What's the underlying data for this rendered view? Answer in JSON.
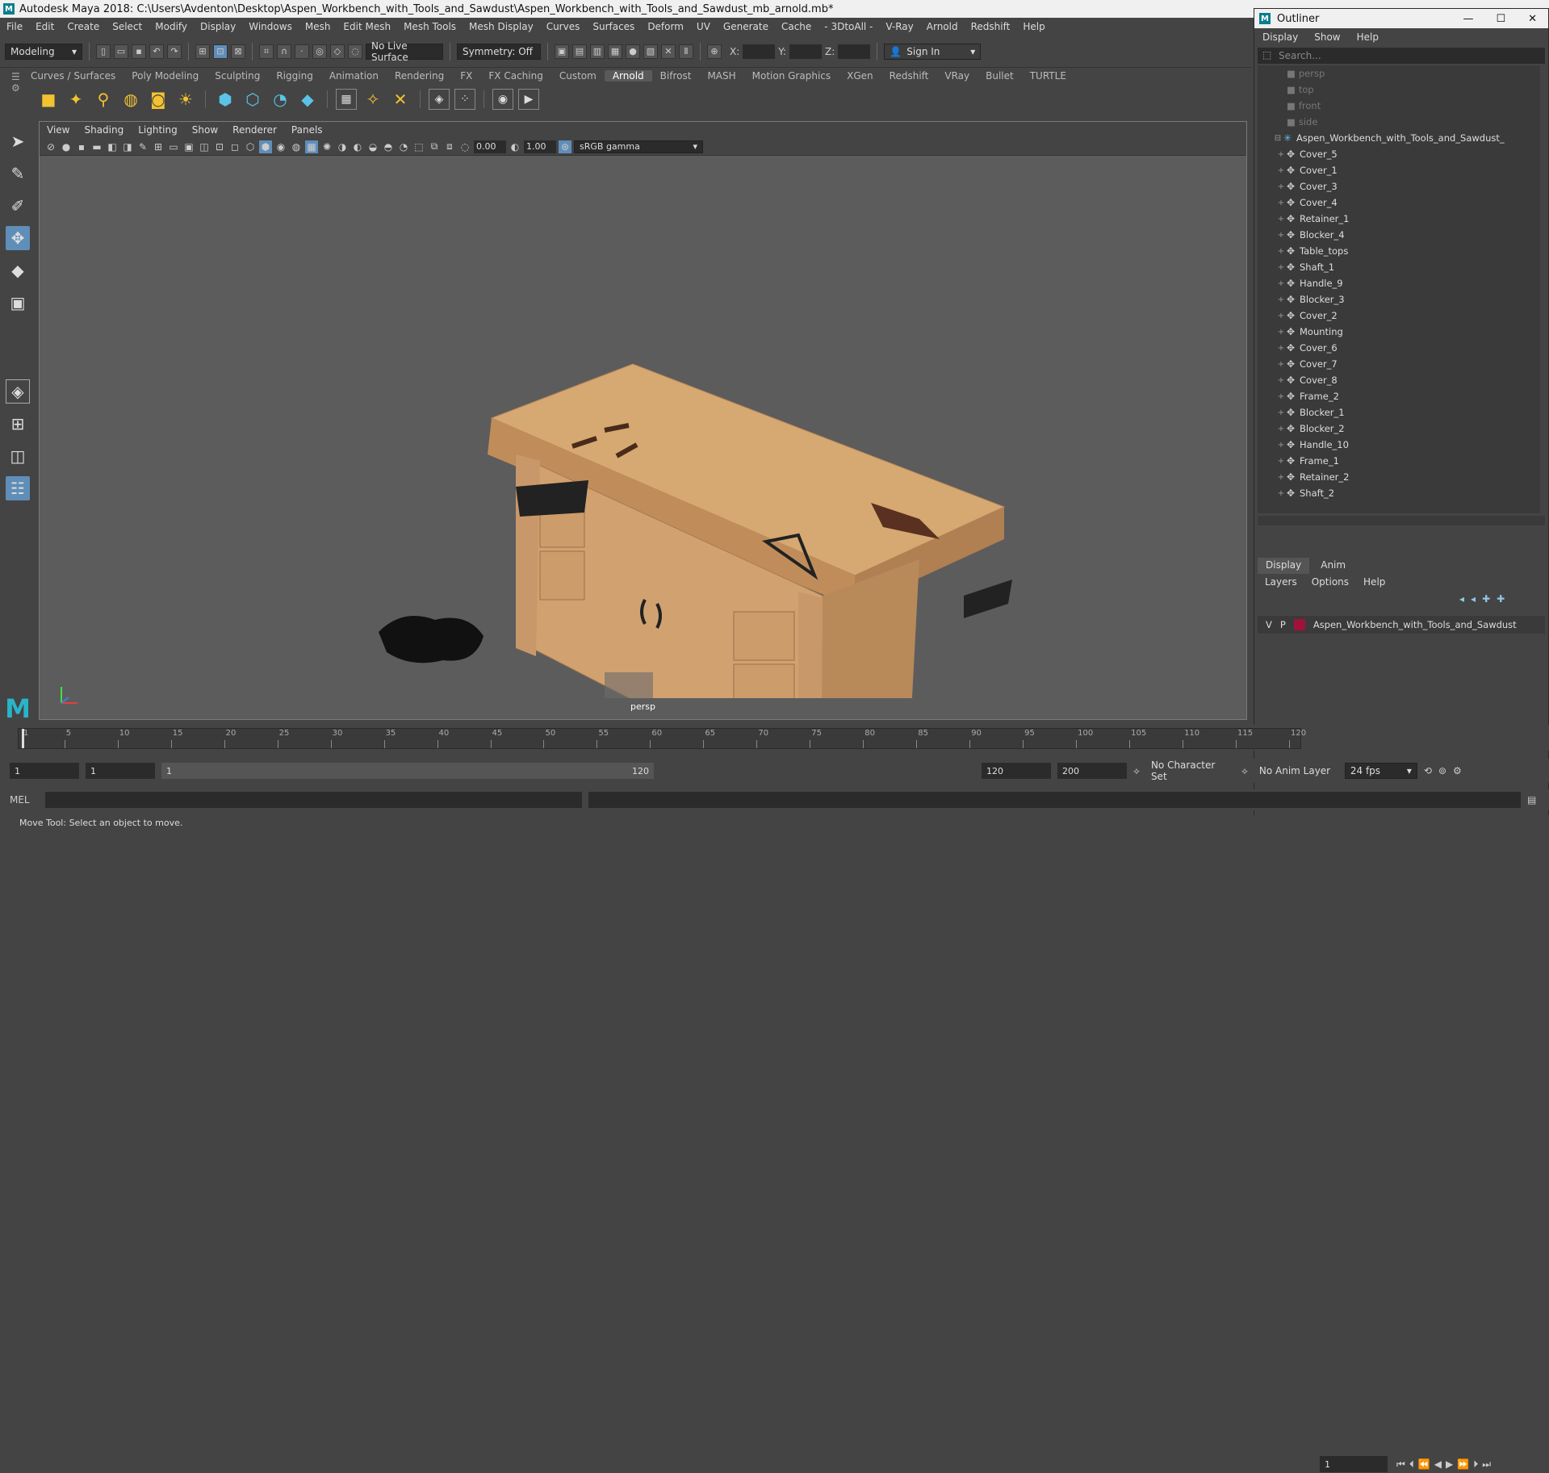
{
  "window": {
    "title": "Autodesk Maya 2018: C:\\Users\\Avdenton\\Desktop\\Aspen_Workbench_with_Tools_and_Sawdust\\Aspen_Workbench_with_Tools_and_Sawdust_mb_arnold.mb*",
    "logo": "M"
  },
  "menubar": [
    "File",
    "Edit",
    "Create",
    "Select",
    "Modify",
    "Display",
    "Windows",
    "Mesh",
    "Edit Mesh",
    "Mesh Tools",
    "Mesh Display",
    "Curves",
    "Surfaces",
    "Deform",
    "UV",
    "Generate",
    "Cache",
    "- 3DtoAll -",
    "V-Ray",
    "Arnold",
    "Redshift",
    "Help"
  ],
  "status": {
    "mode": "Modeling",
    "live_surface": "No Live Surface",
    "symmetry": "Symmetry: Off",
    "x_label": "X:",
    "y_label": "Y:",
    "z_label": "Z:",
    "sign_in": "Sign In"
  },
  "shelf_tabs": [
    "Curves / Surfaces",
    "Poly Modeling",
    "Sculpting",
    "Rigging",
    "Animation",
    "Rendering",
    "FX",
    "FX Caching",
    "Custom",
    "Arnold",
    "Bifrost",
    "MASH",
    "Motion Graphics",
    "XGen",
    "Redshift",
    "VRay",
    "Bullet",
    "TURTLE"
  ],
  "shelf_active": "Arnold",
  "viewport": {
    "menu": [
      "View",
      "Shading",
      "Lighting",
      "Show",
      "Renderer",
      "Panels"
    ],
    "exposure": "0.00",
    "gamma": "1.00",
    "color_space": "sRGB gamma",
    "camera": "persp"
  },
  "outliner": {
    "title": "Outliner",
    "menu": [
      "Display",
      "Show",
      "Help"
    ],
    "search_placeholder": "Search...",
    "cameras": [
      "persp",
      "top",
      "front",
      "side"
    ],
    "root": "Aspen_Workbench_with_Tools_and_Sawdust_",
    "children": [
      "Cover_5",
      "Cover_1",
      "Cover_3",
      "Cover_4",
      "Retainer_1",
      "Blocker_4",
      "Table_tops",
      "Shaft_1",
      "Handle_9",
      "Blocker_3",
      "Cover_2",
      "Mounting",
      "Cover_6",
      "Cover_7",
      "Cover_8",
      "Frame_2",
      "Blocker_1",
      "Blocker_2",
      "Handle_10",
      "Frame_1",
      "Retainer_2",
      "Shaft_2"
    ]
  },
  "layers": {
    "tabs": [
      "Display",
      "Anim"
    ],
    "menu": [
      "Layers",
      "Options",
      "Help"
    ],
    "row": {
      "v": "V",
      "p": "P",
      "name": "Aspen_Workbench_with_Tools_and_Sawdust",
      "color": "#a0123a"
    }
  },
  "timeline": {
    "ticks": [
      "1",
      "5",
      "10",
      "15",
      "20",
      "25",
      "30",
      "35",
      "40",
      "45",
      "50",
      "55",
      "60",
      "65",
      "70",
      "75",
      "80",
      "85",
      "90",
      "95",
      "100",
      "105",
      "110",
      "115",
      "120"
    ],
    "current_frame": "1"
  },
  "range": {
    "start": "1",
    "playback_start": "1",
    "slider_start": "1",
    "slider_end": "120",
    "playback_end": "120",
    "end": "200",
    "character_set": "No Character Set",
    "anim_layer": "No Anim Layer",
    "fps": "24 fps"
  },
  "mel": {
    "label": "MEL"
  },
  "help_line": "Move Tool: Select an object to move."
}
